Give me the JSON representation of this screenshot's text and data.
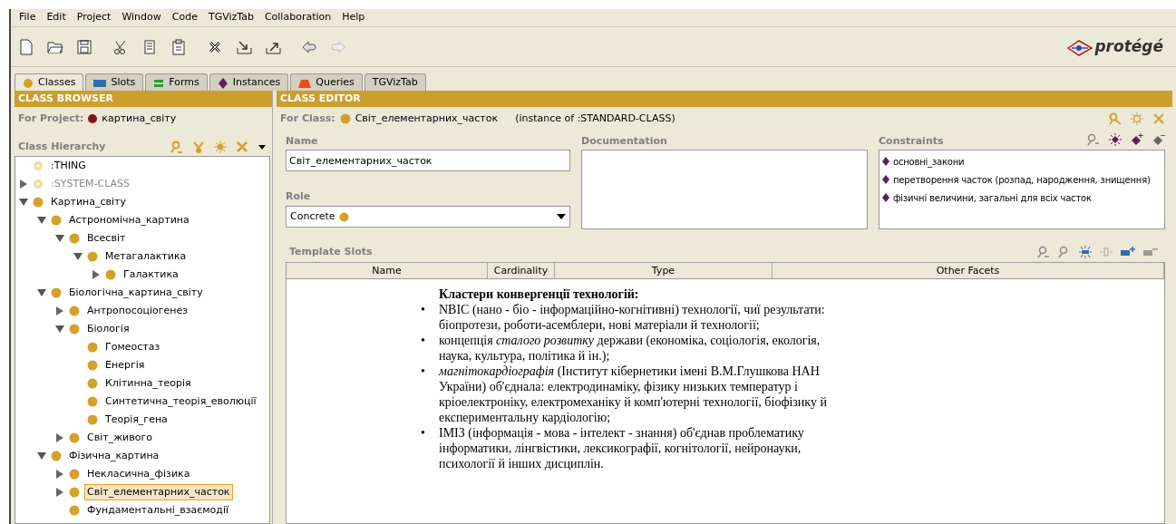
{
  "menu": [
    "File",
    "Edit",
    "Project",
    "Window",
    "Code",
    "TGVizTab",
    "Collaboration",
    "Help"
  ],
  "logo": "protégé",
  "tabs": [
    {
      "label": "Classes",
      "kind": "class",
      "selected": true
    },
    {
      "label": "Slots",
      "kind": "slot",
      "selected": false
    },
    {
      "label": "Forms",
      "kind": "form",
      "selected": false
    },
    {
      "label": "Instances",
      "kind": "instance",
      "selected": false
    },
    {
      "label": "Queries",
      "kind": "query",
      "selected": false
    },
    {
      "label": "TGVizTab",
      "kind": "plain",
      "selected": false
    }
  ],
  "class_browser": {
    "title": "CLASS BROWSER",
    "project_label": "For Project:",
    "project": "картина_світу",
    "hierarchy_label": "Class Hierarchy",
    "tree": [
      {
        "label": ":THING",
        "kind": "system",
        "disabled": false
      },
      {
        "label": ":SYSTEM-CLASS",
        "kind": "system",
        "disabled": true,
        "expanded": false
      },
      {
        "label": "Картина_світу",
        "kind": "class",
        "disabled": false,
        "expanded": true,
        "children": [
          {
            "label": "Астрономічна_картина",
            "kind": "class",
            "disabled": false,
            "expanded": true,
            "children": [
              {
                "label": "Всесвіт",
                "kind": "class",
                "disabled": false,
                "expanded": true,
                "children": [
                  {
                    "label": "Метагалактика",
                    "kind": "class",
                    "disabled": false,
                    "expanded": true,
                    "children": [
                      {
                        "label": "Галактика",
                        "kind": "class",
                        "disabled": false,
                        "expanded": false
                      }
                    ]
                  }
                ]
              }
            ]
          },
          {
            "label": "Біологічна_картина_світу",
            "kind": "class",
            "disabled": false,
            "expanded": true,
            "children": [
              {
                "label": "Антропосоціогенез",
                "kind": "class",
                "disabled": false,
                "expanded": false
              },
              {
                "label": "Біологія",
                "kind": "class",
                "disabled": false,
                "expanded": true,
                "children": [
                  {
                    "label": "Гомеостаз",
                    "kind": "class",
                    "disabled": false
                  },
                  {
                    "label": "Енергія",
                    "kind": "class",
                    "disabled": false
                  },
                  {
                    "label": "Клітинна_теорія",
                    "kind": "class",
                    "disabled": false
                  },
                  {
                    "label": "Синтетична_теорія_еволюції",
                    "kind": "class",
                    "disabled": false
                  },
                  {
                    "label": "Теорія_гена",
                    "kind": "class",
                    "disabled": false
                  }
                ]
              },
              {
                "label": "Світ_живого",
                "kind": "class",
                "disabled": false,
                "expanded": false
              }
            ]
          },
          {
            "label": "Фізична_картина",
            "kind": "class",
            "disabled": false,
            "expanded": true,
            "children": [
              {
                "label": "Некласична_фізика",
                "kind": "class",
                "disabled": false,
                "expanded": false
              },
              {
                "label": "Світ_елементарних_часток",
                "kind": "class",
                "disabled": false,
                "expanded": false,
                "selected": true
              },
              {
                "label": "Фундаментальні_взаємодії",
                "kind": "class",
                "disabled": false
              }
            ]
          }
        ]
      }
    ]
  },
  "class_editor": {
    "title": "CLASS EDITOR",
    "class_label": "For Class:",
    "class_name": "Світ_елементарних_часток",
    "instance_of": "(instance of :STANDARD-CLASS)",
    "name_label": "Name",
    "name_value": "Світ_елементарних_часток",
    "documentation_label": "Documentation",
    "role_label": "Role",
    "role_value": "Concrete",
    "constraints_label": "Constraints",
    "constraints": [
      "основні_закони",
      "перетворення часток (розпад, народження, знищення)",
      "фізичні величини, загальні для всіх часток"
    ],
    "template_slots_label": "Template Slots",
    "columns": [
      "Name",
      "Cardinality",
      "Type",
      "Other Facets"
    ]
  },
  "overlay_text": {
    "heading": "Кластери конвергенції технологій:",
    "bullets": [
      {
        "marker": "•",
        "text": "NBIC (нано - біо - інформаційно-когнітивні) технології, чиї результати: біопротези, роботи-асемблери, нові матеріали й технології;"
      },
      {
        "marker": "•",
        "text": "концепція *сталого розвитку* держави (економіка, соціологія, екологія, наука, культура, політика й ін.);"
      },
      {
        "marker": "•",
        "text": "*магнітокардіографія* (Інститут кібернетики імені В.М.Глушкова НАН України) об'єднала: електродинаміку, фізику низьких температур і кріоелектроніку, електромеханіку й комп'ютерні технології, біофізику й експериментальну кардіологію;"
      },
      {
        "marker": "•",
        "text": "ІМІЗ (інформація - мова - інтелект - знання) об'єднав проблематику інформатики, лінгвістики, лексикографії, когнітології, нейронауки, психології й інших дисциплін."
      }
    ]
  }
}
